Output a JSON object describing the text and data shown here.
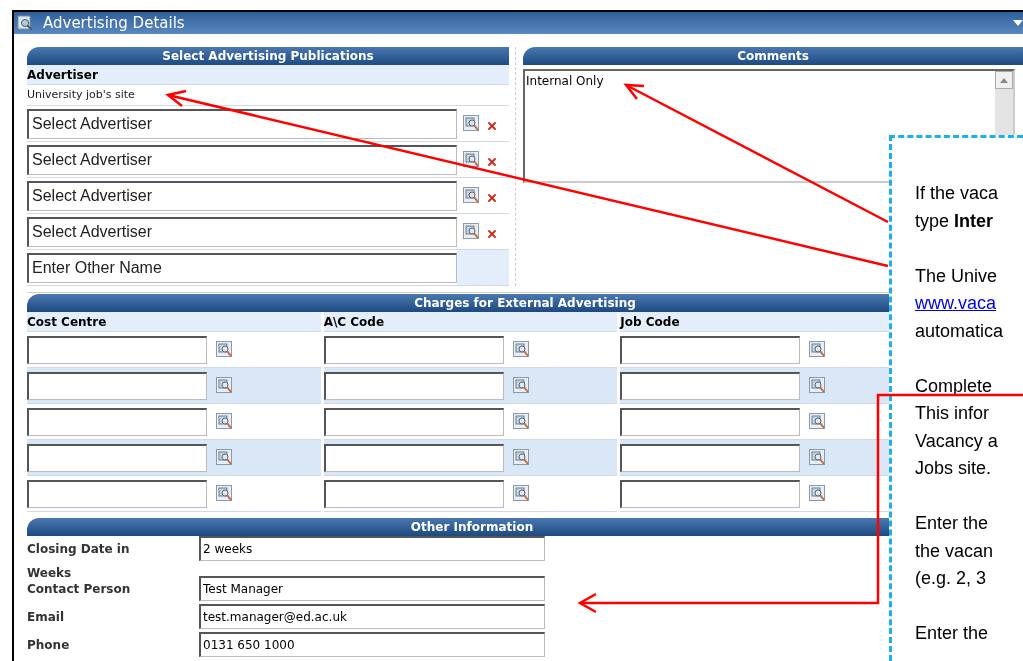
{
  "window": {
    "title": "Advertising Details"
  },
  "publications": {
    "header": "Select Advertising Publications",
    "label": "Advertiser",
    "current": "University job's site",
    "selectors": [
      {
        "kind": "lookup",
        "placeholder": "Select Advertiser"
      },
      {
        "kind": "lookup",
        "placeholder": "Select Advertiser"
      },
      {
        "kind": "lookup",
        "placeholder": "Select Advertiser"
      },
      {
        "kind": "lookup",
        "placeholder": "Select Advertiser"
      },
      {
        "kind": "text",
        "placeholder": "Enter Other Name"
      }
    ]
  },
  "comments": {
    "header": "Comments",
    "value": "Internal Only"
  },
  "charges": {
    "header": "Charges for External Advertising",
    "columns": [
      "Cost Centre",
      "A\\C Code",
      "Job Code"
    ],
    "rows": [
      {
        "shaded": false
      },
      {
        "shaded": true
      },
      {
        "shaded": false
      },
      {
        "shaded": true
      },
      {
        "shaded": false
      }
    ]
  },
  "other": {
    "header": "Other Information",
    "fields": [
      {
        "label": "Closing Date in Weeks",
        "value": "2 weeks"
      },
      {
        "label": "Contact Person",
        "value": "Test Manager"
      },
      {
        "label": "Email",
        "value": "test.manager@ed.ac.uk"
      },
      {
        "label": "Phone",
        "value": "0131 650 1000"
      }
    ]
  },
  "callout": {
    "paragraphs": [
      {
        "lines": [
          {
            "kind": "text",
            "text": "If the vaca"
          },
          {
            "kind": "text",
            "text": "type **Inter**"
          }
        ]
      },
      {
        "lines": [
          {
            "kind": "text",
            "text": "The Unive"
          },
          {
            "kind": "link",
            "text": "www.vaca"
          },
          {
            "kind": "text",
            "text": "automatica"
          }
        ]
      },
      {
        "lines": [
          {
            "kind": "text",
            "text": "Complete"
          },
          {
            "kind": "text",
            "text": "This infor"
          },
          {
            "kind": "text",
            "text": "Vacancy a"
          },
          {
            "kind": "text",
            "text": "Jobs site."
          }
        ]
      },
      {
        "lines": [
          {
            "kind": "text",
            "text": "Enter the"
          },
          {
            "kind": "text",
            "text": "the vacan"
          },
          {
            "kind": "text",
            "text": "(e.g. 2, 3"
          }
        ]
      },
      {
        "lines": [
          {
            "kind": "text",
            "text": "Enter the"
          }
        ]
      }
    ]
  }
}
